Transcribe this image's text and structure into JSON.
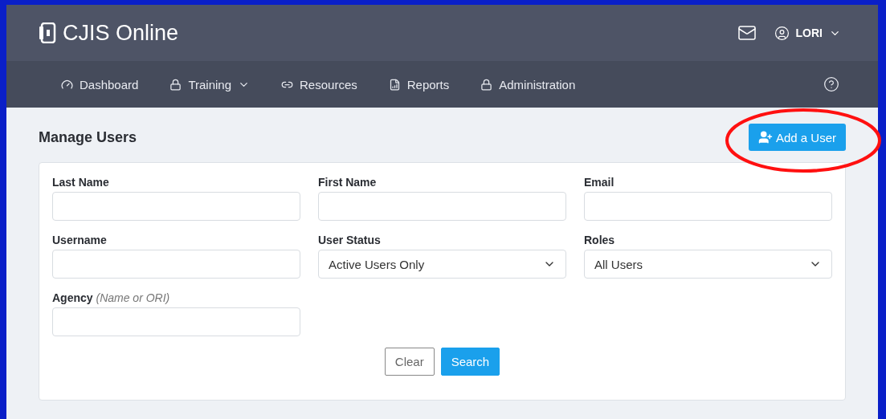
{
  "header": {
    "logo": "CJIS Online",
    "user": "LORI"
  },
  "nav": [
    {
      "label": "Dashboard",
      "dropdown": false
    },
    {
      "label": "Training",
      "dropdown": true
    },
    {
      "label": "Resources",
      "dropdown": false
    },
    {
      "label": "Reports",
      "dropdown": false
    },
    {
      "label": "Administration",
      "dropdown": false
    }
  ],
  "page": {
    "title": "Manage Users",
    "add_button": "Add a User"
  },
  "fields": [
    {
      "label": "Last Name",
      "kind": "text"
    },
    {
      "label": "First Name",
      "kind": "text"
    },
    {
      "label": "Email",
      "kind": "text"
    },
    {
      "label": "Username",
      "kind": "text"
    },
    {
      "label": "User Status",
      "kind": "select",
      "value": "Active Users Only"
    },
    {
      "label": "Roles",
      "kind": "select",
      "value": "All Users"
    },
    {
      "label": "Agency *(Name or ORI)*",
      "kind": "text"
    }
  ],
  "buttons": [
    {
      "label": "Clear",
      "kind": "secondary"
    },
    {
      "label": "Search",
      "kind": "primary"
    }
  ]
}
